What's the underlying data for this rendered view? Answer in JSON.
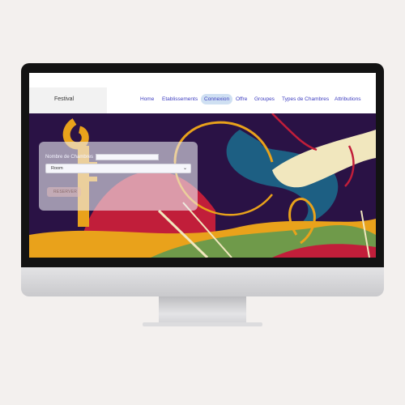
{
  "nav": {
    "brand": "Festival",
    "items": [
      {
        "label": "Home",
        "active": false
      },
      {
        "label": "Etablissements",
        "active": false
      },
      {
        "label": "Connexion",
        "active": true
      },
      {
        "label": "Offre",
        "active": false
      },
      {
        "label": "Groupes",
        "active": false
      },
      {
        "label": "Types de Chambres",
        "active": false
      },
      {
        "label": "Attributions",
        "active": false
      }
    ]
  },
  "form": {
    "field_label": "Nombre de Chambres",
    "number_value": "",
    "select_value": "Room",
    "submit_label": "RESERVER"
  },
  "colors": {
    "nav_link": "#3e3ec0",
    "active_tab_bg": "#cfe0f2",
    "hero_bg": "#2a1245",
    "accent_red": "#c11e3a",
    "accent_yellow": "#e9a21b",
    "accent_teal": "#1d5f83",
    "accent_cream": "#f1e7be",
    "accent_green": "#6f9a4a"
  }
}
